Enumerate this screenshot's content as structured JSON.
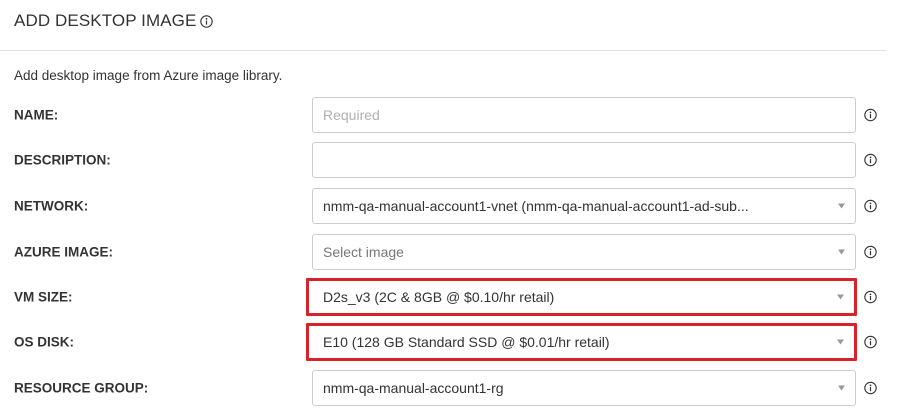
{
  "header": {
    "title": "ADD DESKTOP IMAGE"
  },
  "intro": "Add desktop image from Azure image library.",
  "fields": {
    "name": {
      "label": "NAME:",
      "value": "",
      "placeholder": "Required"
    },
    "description": {
      "label": "DESCRIPTION:",
      "value": ""
    },
    "network": {
      "label": "NETWORK:",
      "value": "nmm-qa-manual-account1-vnet (nmm-qa-manual-account1-ad-sub..."
    },
    "azure_image": {
      "label": "AZURE IMAGE:",
      "value": "Select image"
    },
    "vm_size": {
      "label": "VM SIZE:",
      "value": "D2s_v3 (2C & 8GB @ $0.10/hr retail)"
    },
    "os_disk": {
      "label": "OS DISK:",
      "value": "E10 (128 GB Standard SSD @ $0.01/hr retail)"
    },
    "resource_group": {
      "label": "RESOURCE GROUP:",
      "value": "nmm-qa-manual-account1-rg"
    }
  },
  "icons": {
    "info": "info-circle-icon",
    "dropdown": "chevron-down-icon"
  },
  "colors": {
    "highlight": "#d8232a",
    "border": "#cccccc",
    "text": "#333333"
  }
}
